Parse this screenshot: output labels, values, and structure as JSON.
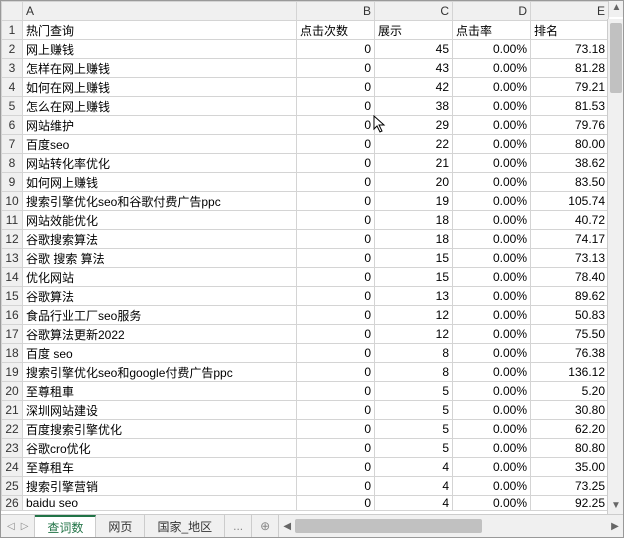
{
  "columns": [
    "A",
    "B",
    "C",
    "D",
    "E"
  ],
  "header_row": {
    "A": "热门查询",
    "B": "点击次数",
    "C": "展示",
    "D": "点击率",
    "E": "排名"
  },
  "rows": [
    {
      "n": 2,
      "A": "网上赚钱",
      "B": "0",
      "C": "45",
      "D": "0.00%",
      "E": "73.18"
    },
    {
      "n": 3,
      "A": "怎样在网上赚钱",
      "B": "0",
      "C": "43",
      "D": "0.00%",
      "E": "81.28"
    },
    {
      "n": 4,
      "A": "如何在网上赚钱",
      "B": "0",
      "C": "42",
      "D": "0.00%",
      "E": "79.21"
    },
    {
      "n": 5,
      "A": "怎么在网上赚钱",
      "B": "0",
      "C": "38",
      "D": "0.00%",
      "E": "81.53"
    },
    {
      "n": 6,
      "A": "网站维护",
      "B": "0",
      "C": "29",
      "D": "0.00%",
      "E": "79.76"
    },
    {
      "n": 7,
      "A": "百度seo",
      "B": "0",
      "C": "22",
      "D": "0.00%",
      "E": "80.00"
    },
    {
      "n": 8,
      "A": "网站转化率优化",
      "B": "0",
      "C": "21",
      "D": "0.00%",
      "E": "38.62"
    },
    {
      "n": 9,
      "A": "如何网上赚钱",
      "B": "0",
      "C": "20",
      "D": "0.00%",
      "E": "83.50"
    },
    {
      "n": 10,
      "A": "搜索引擎优化seo和谷歌付费广告ppc",
      "B": "0",
      "C": "19",
      "D": "0.00%",
      "E": "105.74"
    },
    {
      "n": 11,
      "A": "网站效能优化",
      "B": "0",
      "C": "18",
      "D": "0.00%",
      "E": "40.72"
    },
    {
      "n": 12,
      "A": "谷歌搜索算法",
      "B": "0",
      "C": "18",
      "D": "0.00%",
      "E": "74.17"
    },
    {
      "n": 13,
      "A": "谷歌 搜索 算法",
      "B": "0",
      "C": "15",
      "D": "0.00%",
      "E": "73.13"
    },
    {
      "n": 14,
      "A": "优化网站",
      "B": "0",
      "C": "15",
      "D": "0.00%",
      "E": "78.40"
    },
    {
      "n": 15,
      "A": "谷歌算法",
      "B": "0",
      "C": "13",
      "D": "0.00%",
      "E": "89.62"
    },
    {
      "n": 16,
      "A": "食品行业工厂seo服务",
      "B": "0",
      "C": "12",
      "D": "0.00%",
      "E": "50.83"
    },
    {
      "n": 17,
      "A": "谷歌算法更新2022",
      "B": "0",
      "C": "12",
      "D": "0.00%",
      "E": "75.50"
    },
    {
      "n": 18,
      "A": "百度 seo",
      "B": "0",
      "C": "8",
      "D": "0.00%",
      "E": "76.38"
    },
    {
      "n": 19,
      "A": "搜索引擎优化seo和google付费广告ppc",
      "B": "0",
      "C": "8",
      "D": "0.00%",
      "E": "136.12"
    },
    {
      "n": 20,
      "A": "至尊租車",
      "B": "0",
      "C": "5",
      "D": "0.00%",
      "E": "5.20"
    },
    {
      "n": 21,
      "A": "深圳网站建设",
      "B": "0",
      "C": "5",
      "D": "0.00%",
      "E": "30.80"
    },
    {
      "n": 22,
      "A": "百度搜索引擎优化",
      "B": "0",
      "C": "5",
      "D": "0.00%",
      "E": "62.20"
    },
    {
      "n": 23,
      "A": "谷歌cro优化",
      "B": "0",
      "C": "5",
      "D": "0.00%",
      "E": "80.80"
    },
    {
      "n": 24,
      "A": "至尊租车",
      "B": "0",
      "C": "4",
      "D": "0.00%",
      "E": "35.00"
    },
    {
      "n": 25,
      "A": "搜索引擎营销",
      "B": "0",
      "C": "4",
      "D": "0.00%",
      "E": "73.25"
    },
    {
      "n": 26,
      "A": "baidu seo",
      "B": "0",
      "C": "4",
      "D": "0.00%",
      "E": "92.25"
    }
  ],
  "tabs": {
    "t1": "查词数",
    "t2": "网页",
    "t3": "国家_地区",
    "more": "...",
    "add": "⊕"
  },
  "nav": {
    "first": "◀",
    "prev": "◁",
    "next": "▷",
    "last": "▶"
  },
  "scroll": {
    "up": "▲",
    "down": "▼",
    "left": "◀",
    "right": "▶"
  }
}
